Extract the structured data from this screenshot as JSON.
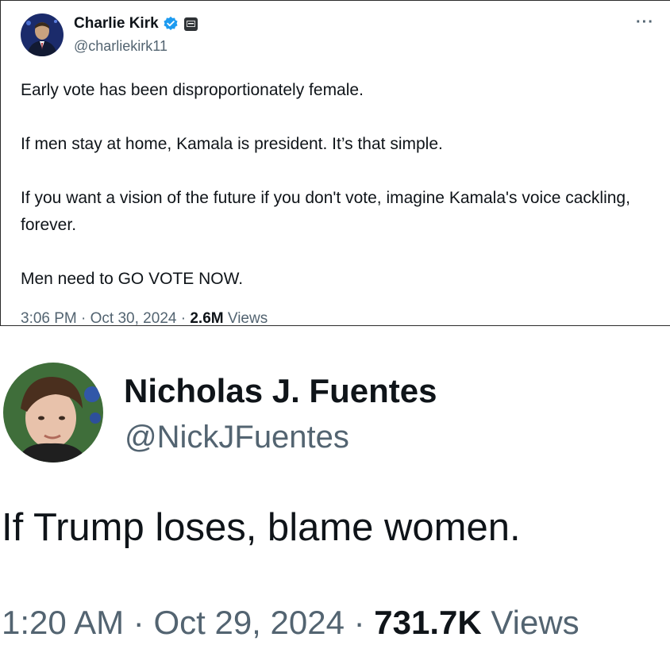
{
  "tweet_top": {
    "author_name": "Charlie Kirk",
    "handle": "@charliekirk11",
    "icons": {
      "verified": "verified-badge-icon",
      "affiliate": "affiliate-badge-icon",
      "more": "more-options-icon"
    },
    "more_label": "···",
    "body": [
      "Early vote has been disproportionately female.",
      "If men stay at home, Kamala is president. It’s that simple.",
      "If you want a vision of the future if you don't vote, imagine Kamala's voice cackling, forever.",
      "Men need to GO VOTE NOW."
    ],
    "time": "3:06 PM",
    "date": "Oct 30, 2024",
    "views_count": "2.6M",
    "views_label": "Views",
    "separator": "·",
    "colors": {
      "verified": "#1d9bf0",
      "secondary_text": "#536471",
      "primary_text": "#0f1419"
    }
  },
  "tweet_bottom": {
    "author_name": "Nicholas J. Fuentes",
    "handle": "@NickJFuentes",
    "body": "If Trump loses, blame women.",
    "time": "1:20 AM",
    "date": "Oct 29, 2024",
    "views_count": "731.7K",
    "views_label": "Views",
    "separator": "·"
  }
}
